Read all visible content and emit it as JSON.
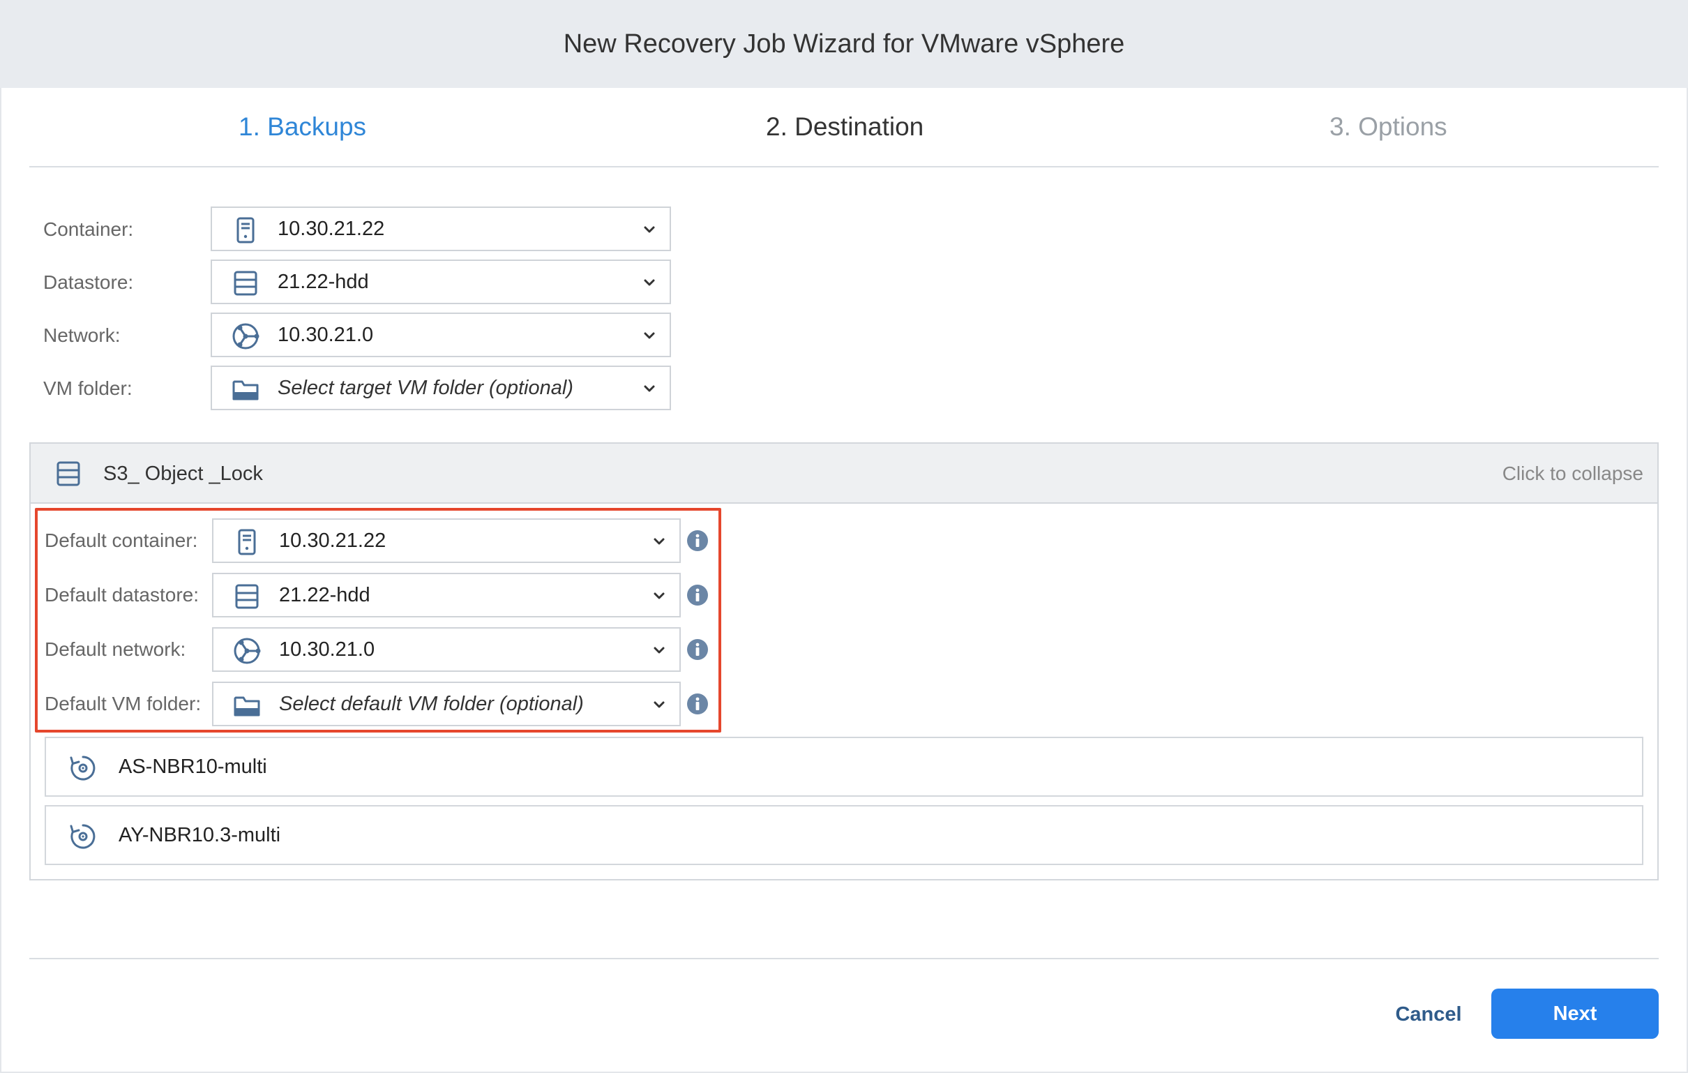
{
  "window": {
    "title": "New Recovery Job Wizard for VMware vSphere"
  },
  "steps": [
    {
      "label": "1. Backups",
      "state": "active"
    },
    {
      "label": "2. Destination",
      "state": "current"
    },
    {
      "label": "3. Options",
      "state": "future"
    }
  ],
  "destination": {
    "container": {
      "label": "Container:",
      "value": "10.30.21.22",
      "icon": "server-icon"
    },
    "datastore": {
      "label": "Datastore:",
      "value": "21.22-hdd",
      "icon": "datastore-icon"
    },
    "network": {
      "label": "Network:",
      "value": "10.30.21.0",
      "icon": "network-icon"
    },
    "vm_folder": {
      "label": "VM folder:",
      "placeholder": "Select target VM folder (optional)",
      "icon": "folder-icon"
    }
  },
  "group": {
    "name": "S3_ Object _Lock",
    "icon": "datastore-icon",
    "collapse_label": "Click to collapse",
    "defaults": {
      "container": {
        "label": "Default container:",
        "value": "10.30.21.22",
        "icon": "server-icon"
      },
      "datastore": {
        "label": "Default datastore:",
        "value": "21.22-hdd",
        "icon": "datastore-icon"
      },
      "network": {
        "label": "Default network:",
        "value": "10.30.21.0",
        "icon": "network-icon"
      },
      "vm_folder": {
        "label": "Default VM folder:",
        "placeholder": "Select default VM folder (optional)",
        "icon": "folder-icon"
      }
    },
    "items": [
      {
        "name": "AS-NBR10-multi",
        "icon": "recovery-point-icon"
      },
      {
        "name": "AY-NBR10.3-multi",
        "icon": "recovery-point-icon"
      }
    ]
  },
  "footer": {
    "cancel_label": "Cancel",
    "next_label": "Next"
  },
  "colors": {
    "accent": "#2f86d7",
    "primary_button": "#2680eb",
    "highlight_border": "#e5472d",
    "icon": "#4a6e96"
  }
}
